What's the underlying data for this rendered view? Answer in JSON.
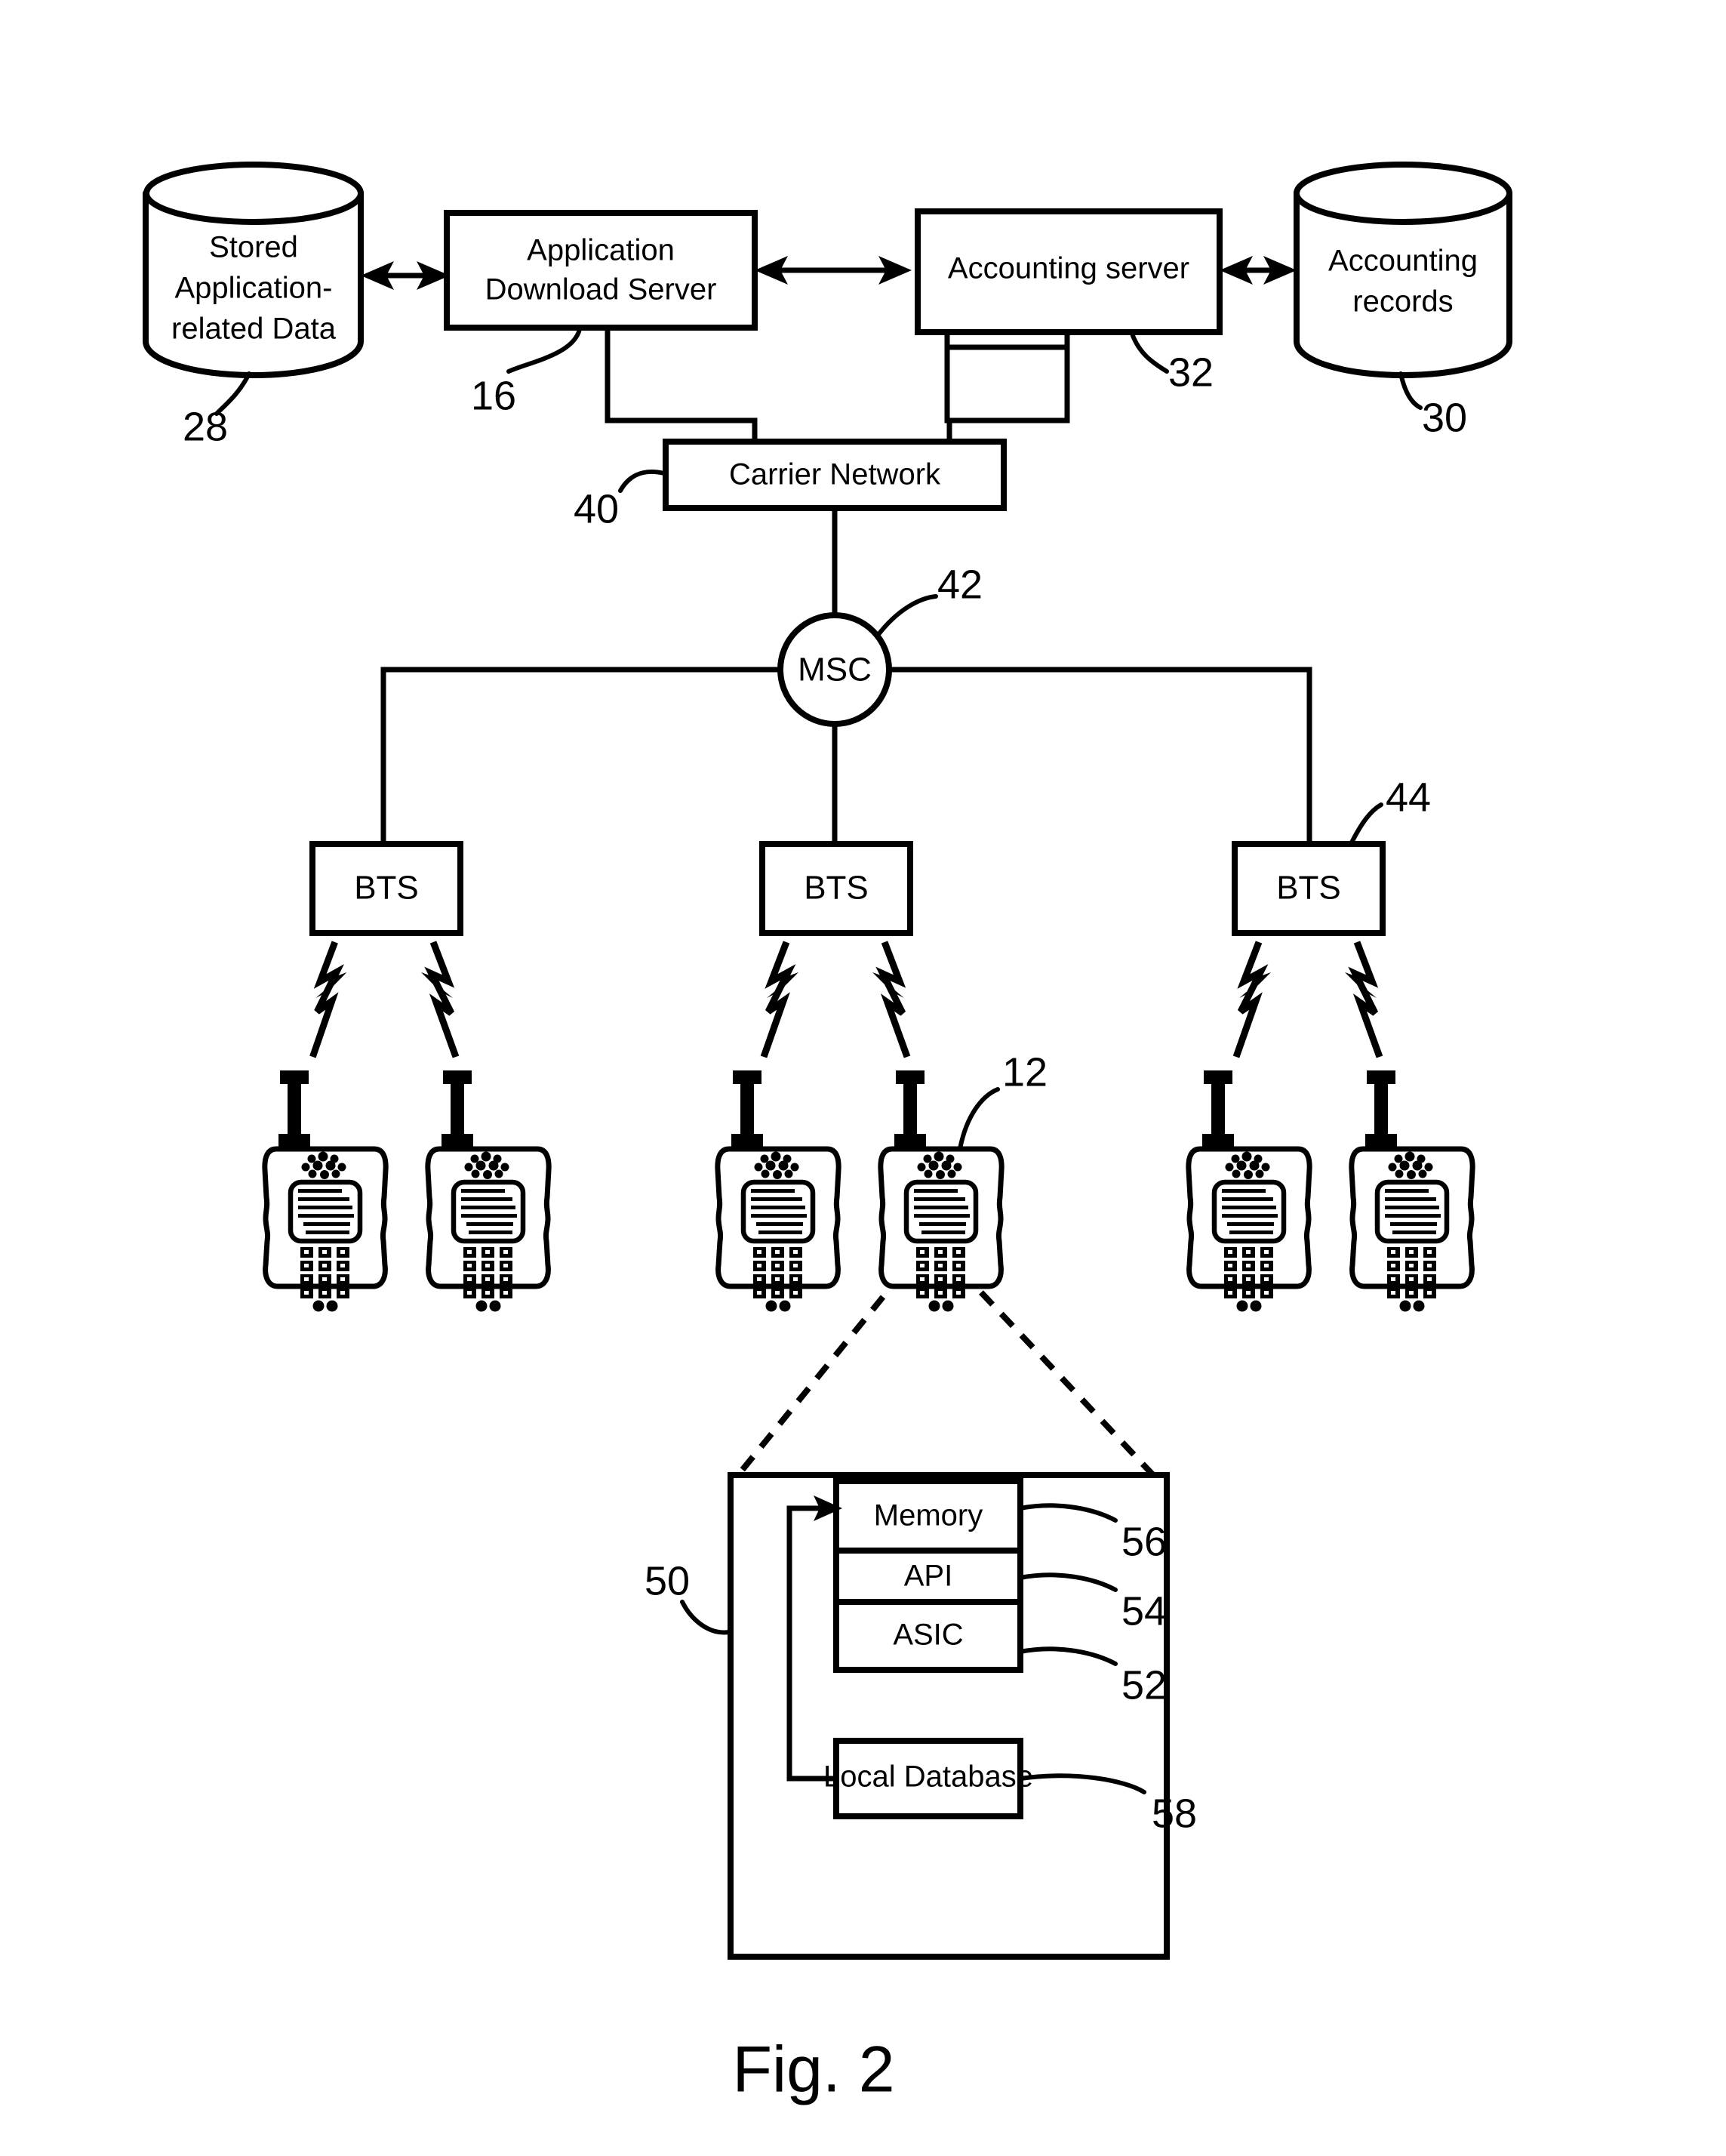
{
  "figure": {
    "caption": "Fig. 2",
    "title": "Application download and accounting network architecture"
  },
  "nodes": {
    "stored_app_data": {
      "label_line1": "Stored",
      "label_line2": "Application-",
      "label_line3": "related Data",
      "ref": "28",
      "shape": "cylinder"
    },
    "app_download_server": {
      "label_line1": "Application",
      "label_line2": "Download Server",
      "ref": "16",
      "shape": "rect"
    },
    "accounting_server": {
      "label_line1": "Accounting server",
      "ref": "32",
      "shape": "rect"
    },
    "accounting_records": {
      "label_line1": "Accounting",
      "label_line2": "records",
      "ref": "30",
      "shape": "cylinder"
    },
    "carrier_network": {
      "label_line1": "Carrier Network",
      "ref": "40",
      "shape": "rect"
    },
    "msc": {
      "label_line1": "MSC",
      "ref": "42",
      "shape": "circle"
    },
    "bts_left": {
      "label_line1": "BTS",
      "shape": "rect"
    },
    "bts_center": {
      "label_line1": "BTS",
      "shape": "rect"
    },
    "bts_right": {
      "label_line1": "BTS",
      "ref": "44",
      "shape": "rect"
    },
    "handset_highlighted": {
      "ref": "12"
    },
    "device_detail": {
      "ref": "50",
      "shape": "rect"
    },
    "memory": {
      "label_line1": "Memory",
      "ref": "56",
      "shape": "rect"
    },
    "api": {
      "label_line1": "API",
      "ref": "54",
      "shape": "rect"
    },
    "asic": {
      "label_line1": "ASIC",
      "ref": "52",
      "shape": "rect"
    },
    "local_database": {
      "label_line1": "Local Database",
      "ref": "58",
      "shape": "rect"
    }
  },
  "handsets": [
    {
      "name": "handset-1"
    },
    {
      "name": "handset-2"
    },
    {
      "name": "handset-3"
    },
    {
      "name": "handset-4"
    },
    {
      "name": "handset-5"
    },
    {
      "name": "handset-6"
    }
  ],
  "colors": {
    "line": "#000000",
    "fill": "#ffffff"
  }
}
